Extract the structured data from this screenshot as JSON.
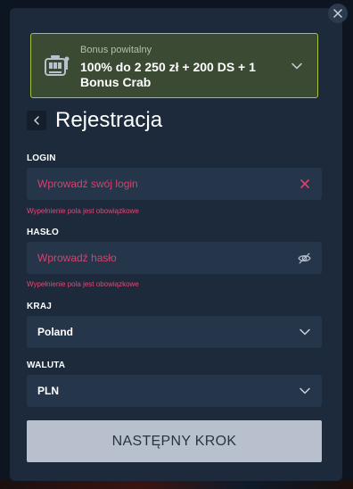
{
  "bonus": {
    "caption": "Bonus powitalny",
    "title": "100% do 2 250 zł + 200 DS + 1 Bonus Crab",
    "icon": "slot-machine-icon"
  },
  "header": {
    "title": "Rejestracja"
  },
  "form": {
    "login": {
      "label": "LOGIN",
      "placeholder": "Wprowadź swój login",
      "error": "Wypełnienie pola jest obowiązkowe"
    },
    "password": {
      "label": "HASŁO",
      "placeholder": "Wprowadź hasło",
      "error": "Wypełnienie pola jest obowiązkowe"
    },
    "country": {
      "label": "KRAJ",
      "value": "Poland"
    },
    "currency": {
      "label": "WALUTA",
      "value": "PLN"
    }
  },
  "submit": {
    "label": "NASTĘPNY KROK"
  },
  "colors": {
    "modal_bg": "#1c2a3b",
    "bonus_border": "#a7c53a",
    "bonus_bg": "#3b4a33",
    "error": "#d9416c",
    "field_bg": "#25354a",
    "button_bg": "#b7c0cc"
  }
}
